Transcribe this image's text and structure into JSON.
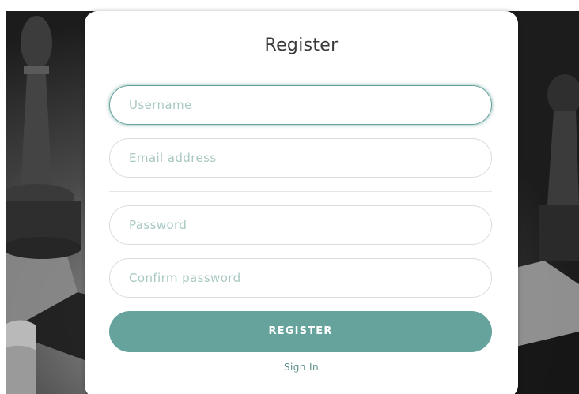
{
  "form": {
    "title": "Register",
    "fields": {
      "username_placeholder": "Username",
      "email_placeholder": "Email address",
      "password_placeholder": "Password",
      "confirm_placeholder": "Confirm password"
    },
    "submit_label": "REGISTER",
    "signin_label": "Sign In"
  },
  "colors": {
    "accent": "#66a39c",
    "placeholder": "#a8c8c3",
    "title": "#3a3a3a"
  }
}
